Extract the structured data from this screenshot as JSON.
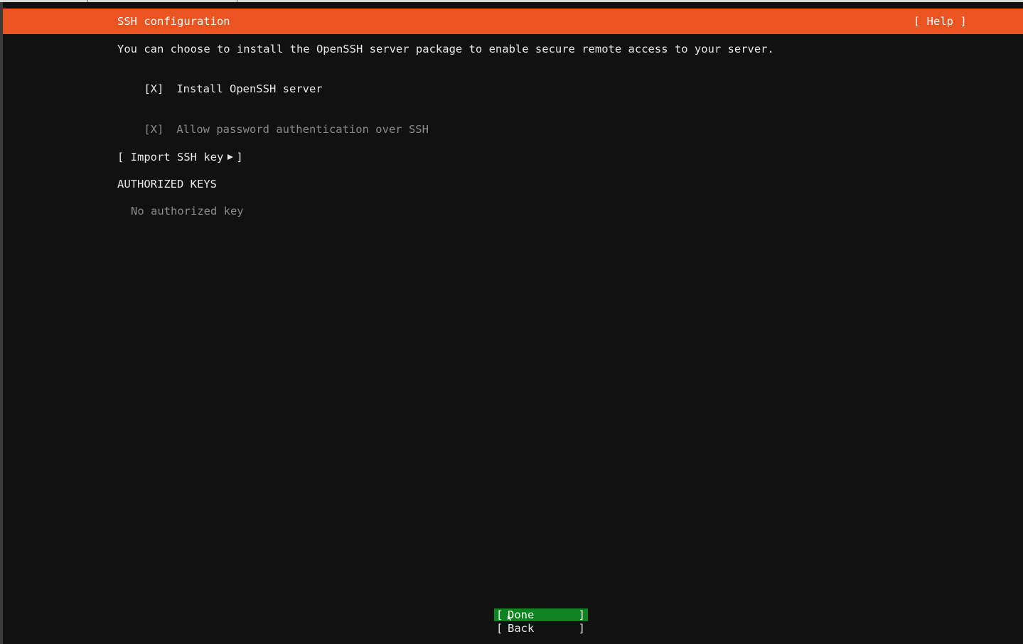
{
  "header": {
    "title": "SSH configuration",
    "help_label": "[ Help ]",
    "accent_color": "#e95420"
  },
  "intro_text": "You can choose to install the OpenSSH server package to enable secure remote access to your server.",
  "install_openssh": {
    "box": "[X]",
    "label": "Install OpenSSH server",
    "checked": true
  },
  "allow_password": {
    "box": "[X]",
    "label": "Allow password authentication over SSH",
    "checked": true,
    "disabled": true
  },
  "import_key": {
    "open": "[ Import SSH key",
    "close": "]",
    "icon": "triangle-right-icon"
  },
  "authorized_keys": {
    "heading": "AUTHORIZED KEYS",
    "empty_text": "No authorized key"
  },
  "buttons": {
    "done_open": "[",
    "done_label": "Done",
    "done_close": "]",
    "back_open": "[",
    "back_label": "Back",
    "back_close": "]",
    "focus_color": "#0e8420"
  }
}
